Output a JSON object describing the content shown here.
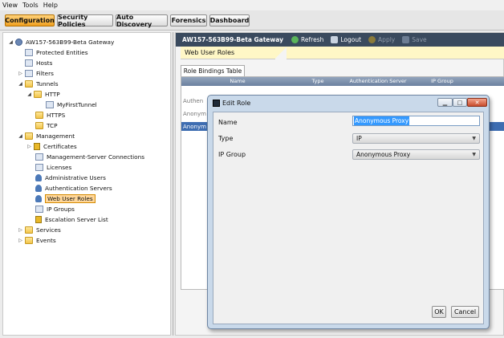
{
  "menu": [
    "View",
    "Tools",
    "Help"
  ],
  "tabs": [
    "Configuration",
    "Security Policies",
    "Auto Discovery",
    "Forensics",
    "Dashboard"
  ],
  "tree": {
    "root": "AW157-563B99-Beta Gateway",
    "protected_entities": "Protected Entities",
    "hosts": "Hosts",
    "filters": "Filters",
    "tunnels": "Tunnels",
    "http": "HTTP",
    "my_first_tunnel": "MyFirstTunnel",
    "https": "HTTPS",
    "tcp": "TCP",
    "management": "Management",
    "certificates": "Certificates",
    "mgmt_server_connections": "Management-Server Connections",
    "licenses": "Licenses",
    "admin_users": "Administrative Users",
    "auth_servers": "Authentication Servers",
    "web_user_roles": "Web User Roles",
    "ip_groups": "IP Groups",
    "escalation_server_list": "Escalation Server List",
    "services": "Services",
    "events": "Events"
  },
  "gateway_bar": {
    "title": "AW157-563B99-Beta Gateway",
    "refresh": "Refresh",
    "logout": "Logout",
    "apply": "Apply",
    "save": "Save"
  },
  "section_title": "Web User Roles",
  "inner_tab": "Role Bindings Table",
  "table": {
    "headers": [
      "Name",
      "Type",
      "Authentication Server",
      "IP Group"
    ],
    "rows": [
      "Authen",
      "Anonym",
      "Anonym"
    ]
  },
  "dialog": {
    "title": "Edit Role",
    "name_label": "Name",
    "name_value": "Anonymous Proxy",
    "type_label": "Type",
    "type_value": "IP",
    "ip_group_label": "IP Group",
    "ip_group_value": "Anonymous Proxy",
    "ok": "OK",
    "cancel": "Cancel"
  }
}
